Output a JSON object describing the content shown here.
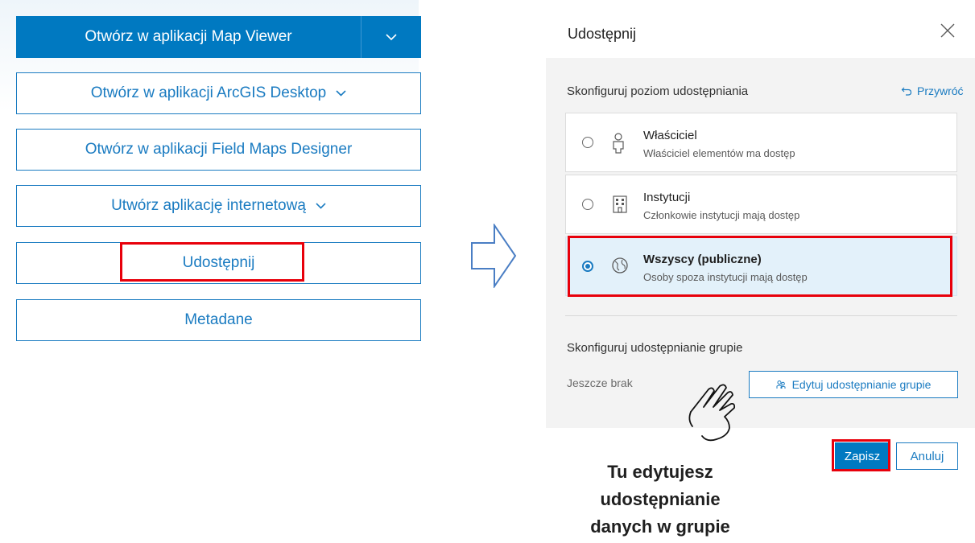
{
  "left_panel": {
    "open_map_viewer": "Otwórz w aplikacji Map Viewer",
    "open_arcgis_desktop": "Otwórz w aplikacji ArcGIS Desktop",
    "open_field_maps": "Otwórz w aplikacji Field Maps Designer",
    "create_web_app": "Utwórz aplikację internetową",
    "share": "Udostępnij",
    "metadata": "Metadane"
  },
  "dialog": {
    "title": "Udostępnij",
    "level_section_title": "Skonfiguruj poziom udostępniania",
    "restore_label": "Przywróć",
    "options": [
      {
        "title": "Właściciel",
        "description": "Właściciel elementów ma dostęp",
        "icon": "user-icon",
        "selected": false
      },
      {
        "title": "Instytucji",
        "description": "Członkowie instytucji mają dostęp",
        "icon": "building-icon",
        "selected": false
      },
      {
        "title": "Wszyscy (publiczne)",
        "description": "Osoby spoza instytucji mają dostęp",
        "icon": "globe-icon",
        "selected": true
      }
    ],
    "group_section_title": "Skonfiguruj udostępnianie grupie",
    "group_none": "Jeszcze brak",
    "edit_group_button": "Edytuj udostępnianie grupie",
    "save_button": "Zapisz",
    "cancel_button": "Anuluj"
  },
  "annotation": {
    "line1": "Tu edytujesz",
    "line2": "udostępnianie",
    "line3": "danych w grupie"
  },
  "colors": {
    "accent": "#0079c1",
    "highlight": "#e8000b",
    "selected_bg": "#e3f1fa"
  }
}
